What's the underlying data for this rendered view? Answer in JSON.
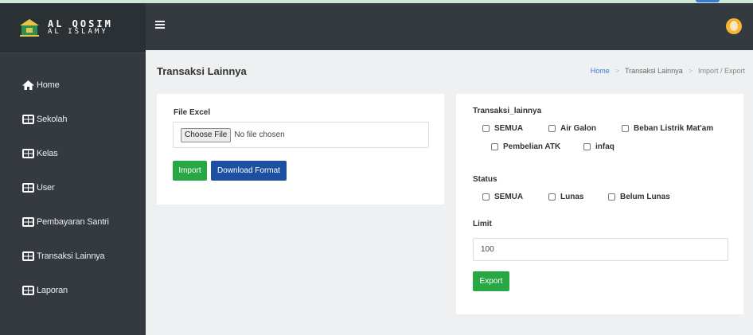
{
  "brand": {
    "line1": "AL QOSIM",
    "line2": "AL ISLAMY"
  },
  "sidebar": {
    "items": [
      {
        "label": "Home",
        "icon": "home-icon"
      },
      {
        "label": "Sekolah",
        "icon": "table-icon"
      },
      {
        "label": "Kelas",
        "icon": "table-icon"
      },
      {
        "label": "User",
        "icon": "table-icon"
      },
      {
        "label": "Pembayaran Santri",
        "icon": "table-icon"
      },
      {
        "label": "Transaksi Lainnya",
        "icon": "table-icon"
      },
      {
        "label": "Laporan",
        "icon": "table-icon"
      }
    ]
  },
  "header": {
    "menu_icon": "hamburger-icon",
    "avatar_icon": "user-avatar-icon"
  },
  "page": {
    "title": "Transaksi Lainnya",
    "breadcrumb": [
      "Home",
      "Transaksi Lainnya",
      "Import / Export"
    ]
  },
  "import_card": {
    "file_label": "File Excel",
    "choose_file": "Choose File",
    "no_file": "No file chosen",
    "import_button": "Import",
    "download_button": "Download Format"
  },
  "export_card": {
    "transaksi_label": "Transaksi_lainnya",
    "transaksi_options": [
      "SEMUA",
      "Air Galon",
      "Beban Listrik Mat'am",
      "Pembelian ATK",
      "infaq"
    ],
    "status_label": "Status",
    "status_options": [
      "SEMUA",
      "Lunas",
      "Belum Lunas"
    ],
    "limit_label": "Limit",
    "limit_value": "100",
    "export_button": "Export"
  },
  "colors": {
    "sidebar": "#343a40",
    "primary_green": "#28a745",
    "primary_blue": "#1d4fa3",
    "link_blue": "#3a7bd5"
  }
}
